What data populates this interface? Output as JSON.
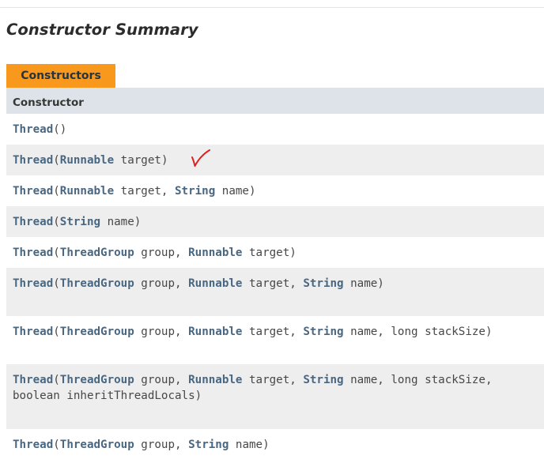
{
  "section": {
    "title": "Constructor Summary",
    "tab_label": "Constructors",
    "column_header": "Constructor"
  },
  "annotation": {
    "mark": "checkmark-red"
  },
  "colors": {
    "tab_bg": "#f8981d",
    "header_bg": "#dee3e9",
    "row_alt_bg": "#eeeeee",
    "link": "#4a6782",
    "annotation": "#e0201e"
  },
  "rows": [
    {
      "name": "Thread",
      "open": "(",
      "close": ")"
    },
    {
      "name": "Thread",
      "open": "(",
      "p1_type": "Runnable",
      "p1_name": " target",
      "close": ")"
    },
    {
      "name": "Thread",
      "open": "(",
      "p1_type": "Runnable",
      "p1_name": " target, ",
      "p2_type": "String",
      "p2_name": " name",
      "close": ")"
    },
    {
      "name": "Thread",
      "open": "(",
      "p1_type": "String",
      "p1_name": " name",
      "close": ")"
    },
    {
      "name": "Thread",
      "open": "(",
      "p1_type": "ThreadGroup",
      "p1_name": " group, ",
      "p2_type": "Runnable",
      "p2_name": " target",
      "close": ")"
    },
    {
      "name": "Thread",
      "open": "(",
      "p1_type": "ThreadGroup",
      "p1_name": " group, ",
      "p2_type": "Runnable",
      "p2_name": " target, ",
      "p3_type": "String",
      "p3_name": " name",
      "close": ")"
    },
    {
      "name": "Thread",
      "open": "(",
      "p1_type": "ThreadGroup",
      "p1_name": " group, ",
      "p2_type": "Runnable",
      "p2_name": " target, ",
      "p3_type": "String",
      "p3_name": " name, long stackSize",
      "close": ")"
    },
    {
      "name": "Thread",
      "open": "(",
      "p1_type": "ThreadGroup",
      "p1_name": " group, ",
      "p2_type": "Runnable",
      "p2_name": " target, ",
      "p3_type": "String",
      "p3_name": " name, long stackSize,\nboolean inheritThreadLocals",
      "close": ")"
    },
    {
      "name": "Thread",
      "open": "(",
      "p1_type": "ThreadGroup",
      "p1_name": " group, ",
      "p2_type": "String",
      "p2_name": " name",
      "close": ")"
    }
  ]
}
